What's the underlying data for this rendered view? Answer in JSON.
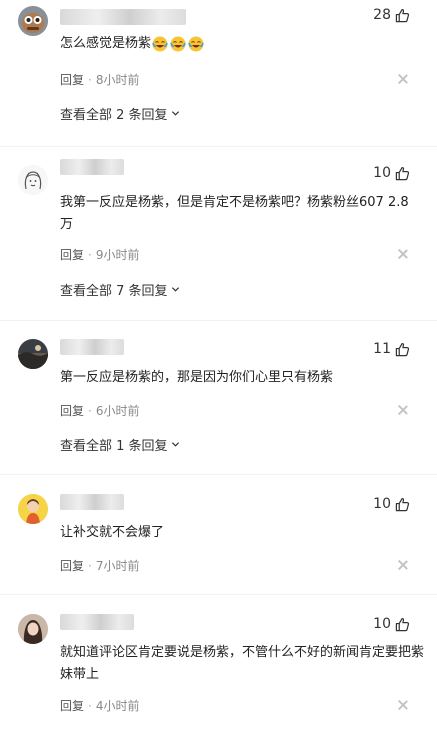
{
  "comments": [
    {
      "likes": "28",
      "text": "怎么感觉是杨紫",
      "emojis": [
        "crying-laugh",
        "crying-laugh",
        "crying-laugh"
      ],
      "reply_label": "回复",
      "time": "8小时前",
      "expand_label": "查看全部 2 条回复"
    },
    {
      "likes": "10",
      "text": "我第一反应是杨紫，但是肯定不是杨紫吧？杨紫粉丝607 2.8万",
      "reply_label": "回复",
      "time": "9小时前",
      "expand_label": "查看全部 7 条回复"
    },
    {
      "likes": "11",
      "text": "第一反应是杨紫的，那是因为你们心里只有杨紫",
      "reply_label": "回复",
      "time": "6小时前",
      "expand_label": "查看全部 1 条回复"
    },
    {
      "likes": "10",
      "text": "让补交就不会爆了",
      "reply_label": "回复",
      "time": "7小时前"
    },
    {
      "likes": "10",
      "text": "就知道评论区肯定要说是杨紫，不管什么不好的新闻肯定要把紫妹带上",
      "reply_label": "回复",
      "time": "4小时前"
    }
  ],
  "colors": {
    "text": "#222222",
    "meta": "#888888",
    "divider": "#f2f2f2"
  }
}
